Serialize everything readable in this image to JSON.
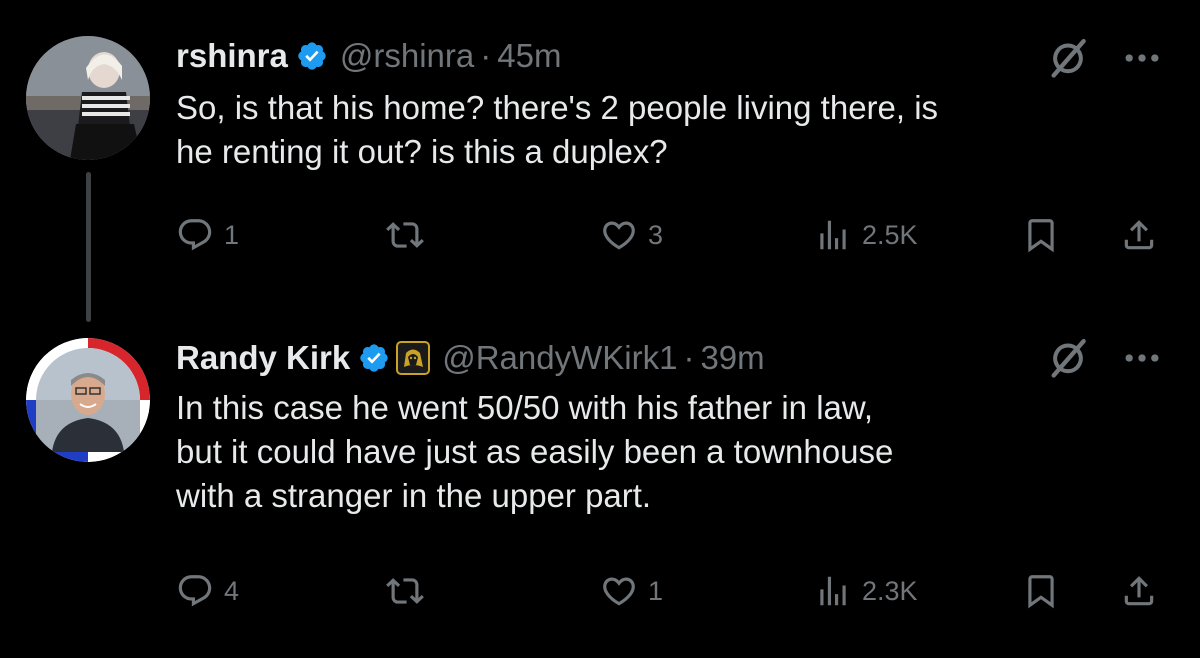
{
  "tweets": [
    {
      "name": "rshinra",
      "handle": "@rshinra",
      "separator": "·",
      "time": "45m",
      "text_lines": [
        "So, is that his home? there's 2 people living there, is",
        "he renting it out? is this a duplex?"
      ],
      "replies": "1",
      "likes": "3",
      "views": "2.5K",
      "avatar_icon": "user-avatar-photo"
    },
    {
      "name": "Randy Kirk",
      "handle": "@RandyWKirk1",
      "separator": "·",
      "time": "39m",
      "text_lines": [
        "In this case he went 50/50 with his father in law,",
        "but it could have just as easily been a townhouse",
        "with a stranger in the upper part."
      ],
      "replies": "4",
      "likes": "1",
      "views": "2.3K",
      "avatar_icon": "user-avatar-photo",
      "affiliate_icon": "lion-affiliate-badge-icon"
    }
  ],
  "colors": {
    "background": "#000000",
    "text": "#e7e9ea",
    "muted": "#71767b",
    "verified": "#1d9bf0",
    "thread_line": "#3e4144"
  }
}
